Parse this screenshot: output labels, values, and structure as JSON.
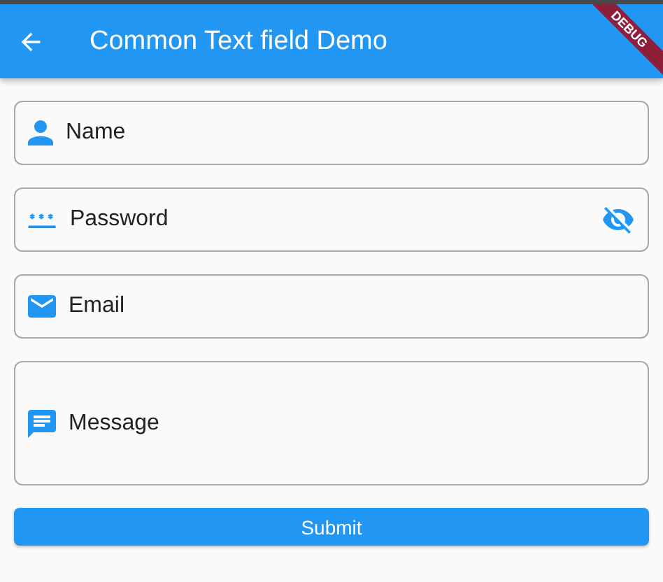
{
  "app_bar": {
    "title": "Common Text field Demo"
  },
  "debug_banner": "DEBUG",
  "fields": [
    {
      "kind": "name",
      "placeholder": "Name"
    },
    {
      "kind": "password",
      "placeholder": "Password"
    },
    {
      "kind": "email",
      "placeholder": "Email"
    },
    {
      "kind": "message",
      "placeholder": "Message"
    }
  ],
  "submit_button": "Submit"
}
